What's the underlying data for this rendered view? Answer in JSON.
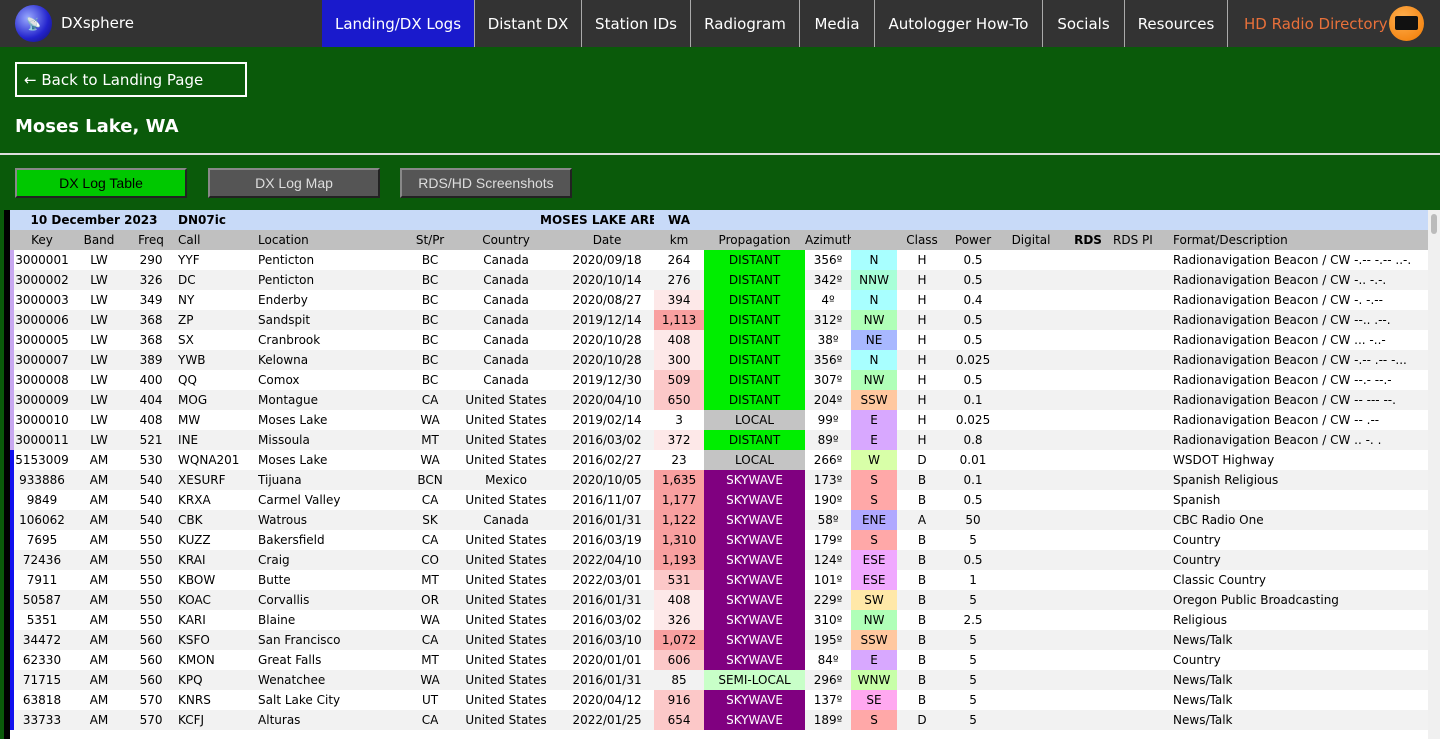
{
  "nav": {
    "brand": "DXsphere",
    "tabs": [
      "Landing/DX Logs",
      "Distant DX",
      "Station IDs",
      "Radiogram",
      "Media",
      "Autologger How-To",
      "Socials",
      "Resources"
    ],
    "hd": "HD Radio Directory",
    "active_color": "#1a1acc",
    "hd_color": "#e8703a"
  },
  "page": {
    "back": "← Back to Landing Page",
    "title": "Moses Lake, WA",
    "views": [
      "DX Log Table",
      "DX Log Map",
      "RDS/HD Screenshots"
    ],
    "active_view_color": "#00c800"
  },
  "info": {
    "date": "10 December 2023",
    "grid": "DN07ic",
    "area": "MOSES LAKE AREA",
    "state": "WA"
  },
  "columns": [
    "Key",
    "Band",
    "Freq",
    "Call",
    "Location",
    "St/Pr",
    "Country",
    "Date",
    "km",
    "Propagation",
    "Azimuth",
    "",
    "Class",
    "Power",
    "Digital",
    "RDS",
    "RDS PI",
    "Format/Description"
  ],
  "band_colors": {
    "LW": "#c8a8f0",
    "AM": "#1010ee"
  },
  "direction_colors": {
    "N": "#a8ffff",
    "NNW": "#a8ffd8",
    "NW": "#b0ffb8",
    "NE": "#a8b8ff",
    "SSW": "#ffc8a0",
    "E": "#d8a8ff",
    "W": "#d8ffa8",
    "S": "#ffa8a8",
    "ENE": "#b0a8ff",
    "ESE": "#f0a8ff",
    "SW": "#ffe8a8",
    "SE": "#ffa8f0",
    "WNW": "#c8ffa8"
  },
  "rows": [
    [
      "3000001",
      "LW",
      "290",
      "YYF",
      "Penticton",
      "BC",
      "Canada",
      "2020/09/18",
      "264",
      "DISTANT",
      "356º",
      "N",
      "H",
      "0.5",
      "",
      "",
      "",
      "Radionavigation Beacon / CW -.-- -.-- ..-."
    ],
    [
      "3000002",
      "LW",
      "326",
      "DC",
      "Penticton",
      "BC",
      "Canada",
      "2020/10/14",
      "276",
      "DISTANT",
      "342º",
      "NNW",
      "H",
      "0.5",
      "",
      "",
      "",
      "Radionavigation Beacon / CW -.. -.-."
    ],
    [
      "3000003",
      "LW",
      "349",
      "NY",
      "Enderby",
      "BC",
      "Canada",
      "2020/08/27",
      "394",
      "DISTANT",
      "4º",
      "N",
      "H",
      "0.4",
      "",
      "",
      "",
      "Radionavigation Beacon / CW -. -.--"
    ],
    [
      "3000006",
      "LW",
      "368",
      "ZP",
      "Sandspit",
      "BC",
      "Canada",
      "2019/12/14",
      "1,113",
      "DISTANT",
      "312º",
      "NW",
      "H",
      "0.5",
      "",
      "",
      "",
      "Radionavigation Beacon / CW --.. .--."
    ],
    [
      "3000005",
      "LW",
      "368",
      "SX",
      "Cranbrook",
      "BC",
      "Canada",
      "2020/10/28",
      "408",
      "DISTANT",
      "38º",
      "NE",
      "H",
      "0.5",
      "",
      "",
      "",
      "Radionavigation Beacon / CW ... -..-"
    ],
    [
      "3000007",
      "LW",
      "389",
      "YWB",
      "Kelowna",
      "BC",
      "Canada",
      "2020/10/28",
      "300",
      "DISTANT",
      "356º",
      "N",
      "H",
      "0.025",
      "",
      "",
      "",
      "Radionavigation Beacon / CW -.-- .-- -..."
    ],
    [
      "3000008",
      "LW",
      "400",
      "QQ",
      "Comox",
      "BC",
      "Canada",
      "2019/12/30",
      "509",
      "DISTANT",
      "307º",
      "NW",
      "H",
      "0.5",
      "",
      "",
      "",
      "Radionavigation Beacon / CW --.- --.-"
    ],
    [
      "3000009",
      "LW",
      "404",
      "MOG",
      "Montague",
      "CA",
      "United States",
      "2020/04/10",
      "650",
      "DISTANT",
      "204º",
      "SSW",
      "H",
      "0.1",
      "",
      "",
      "",
      "Radionavigation Beacon / CW -- --- --."
    ],
    [
      "3000010",
      "LW",
      "408",
      "MW",
      "Moses Lake",
      "WA",
      "United States",
      "2019/02/14",
      "3",
      "LOCAL",
      "99º",
      "E",
      "H",
      "0.025",
      "",
      "",
      "",
      "Radionavigation Beacon / CW -- .--"
    ],
    [
      "3000011",
      "LW",
      "521",
      "INE",
      "Missoula",
      "MT",
      "United States",
      "2016/03/02",
      "372",
      "DISTANT",
      "89º",
      "E",
      "H",
      "0.8",
      "",
      "",
      "",
      "Radionavigation Beacon / CW .. -. ."
    ],
    [
      "5153009",
      "AM",
      "530",
      "WQNA201",
      "Moses Lake",
      "WA",
      "United States",
      "2016/02/27",
      "23",
      "LOCAL",
      "266º",
      "W",
      "D",
      "0.01",
      "",
      "",
      "",
      "WSDOT Highway"
    ],
    [
      "933886",
      "AM",
      "540",
      "XESURF",
      "Tijuana",
      "BCN",
      "Mexico",
      "2020/10/05",
      "1,635",
      "SKYWAVE",
      "173º",
      "S",
      "B",
      "0.1",
      "",
      "",
      "",
      "Spanish Religious"
    ],
    [
      "9849",
      "AM",
      "540",
      "KRXA",
      "Carmel Valley",
      "CA",
      "United States",
      "2016/11/07",
      "1,177",
      "SKYWAVE",
      "190º",
      "S",
      "B",
      "0.5",
      "",
      "",
      "",
      "Spanish"
    ],
    [
      "106062",
      "AM",
      "540",
      "CBK",
      "Watrous",
      "SK",
      "Canada",
      "2016/01/31",
      "1,122",
      "SKYWAVE",
      "58º",
      "ENE",
      "A",
      "50",
      "",
      "",
      "",
      "CBC Radio One"
    ],
    [
      "7695",
      "AM",
      "550",
      "KUZZ",
      "Bakersfield",
      "CA",
      "United States",
      "2016/03/19",
      "1,310",
      "SKYWAVE",
      "179º",
      "S",
      "B",
      "5",
      "",
      "",
      "",
      "Country"
    ],
    [
      "72436",
      "AM",
      "550",
      "KRAI",
      "Craig",
      "CO",
      "United States",
      "2022/04/10",
      "1,193",
      "SKYWAVE",
      "124º",
      "ESE",
      "B",
      "0.5",
      "",
      "",
      "",
      "Country"
    ],
    [
      "7911",
      "AM",
      "550",
      "KBOW",
      "Butte",
      "MT",
      "United States",
      "2022/03/01",
      "531",
      "SKYWAVE",
      "101º",
      "ESE",
      "B",
      "1",
      "",
      "",
      "",
      "Classic Country"
    ],
    [
      "50587",
      "AM",
      "550",
      "KOAC",
      "Corvallis",
      "OR",
      "United States",
      "2016/01/31",
      "408",
      "SKYWAVE",
      "229º",
      "SW",
      "B",
      "5",
      "",
      "",
      "",
      "Oregon Public Broadcasting"
    ],
    [
      "5351",
      "AM",
      "550",
      "KARI",
      "Blaine",
      "WA",
      "United States",
      "2016/03/02",
      "326",
      "SKYWAVE",
      "310º",
      "NW",
      "B",
      "2.5",
      "",
      "",
      "",
      "Religious"
    ],
    [
      "34472",
      "AM",
      "560",
      "KSFO",
      "San Francisco",
      "CA",
      "United States",
      "2016/03/10",
      "1,072",
      "SKYWAVE",
      "195º",
      "SSW",
      "B",
      "5",
      "",
      "",
      "",
      "News/Talk"
    ],
    [
      "62330",
      "AM",
      "560",
      "KMON",
      "Great Falls",
      "MT",
      "United States",
      "2020/01/01",
      "606",
      "SKYWAVE",
      "84º",
      "E",
      "B",
      "5",
      "",
      "",
      "",
      "Country"
    ],
    [
      "71715",
      "AM",
      "560",
      "KPQ",
      "Wenatchee",
      "WA",
      "United States",
      "2016/01/31",
      "85",
      "SEMI-LOCAL",
      "296º",
      "WNW",
      "B",
      "5",
      "",
      "",
      "",
      "News/Talk"
    ],
    [
      "63818",
      "AM",
      "570",
      "KNRS",
      "Salt Lake City",
      "UT",
      "United States",
      "2020/04/12",
      "916",
      "SKYWAVE",
      "137º",
      "SE",
      "B",
      "5",
      "",
      "",
      "",
      "News/Talk"
    ],
    [
      "33733",
      "AM",
      "570",
      "KCFJ",
      "Alturas",
      "CA",
      "United States",
      "2022/01/25",
      "654",
      "SKYWAVE",
      "189º",
      "S",
      "D",
      "5",
      "",
      "",
      "",
      "News/Talk"
    ]
  ]
}
